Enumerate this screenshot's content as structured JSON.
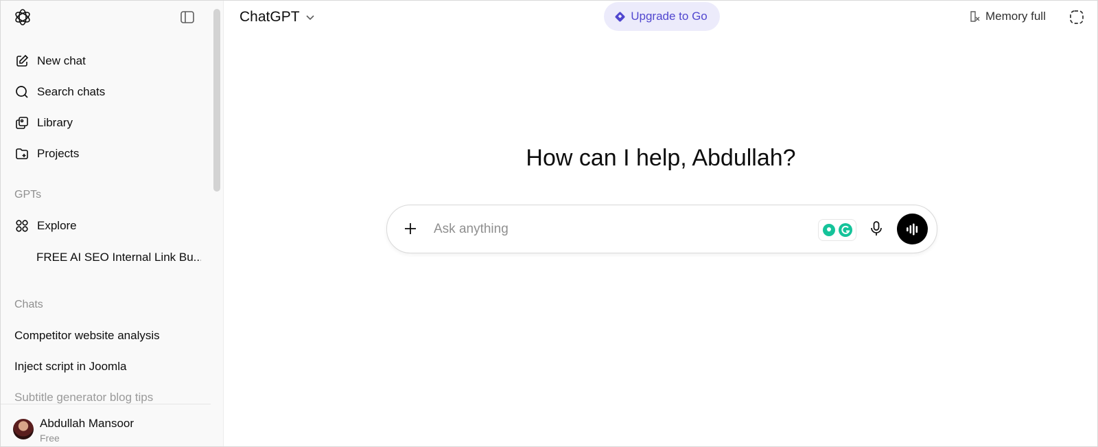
{
  "sidebar": {
    "nav": [
      {
        "label": "New chat",
        "icon": "new-chat-icon"
      },
      {
        "label": "Search chats",
        "icon": "search-icon"
      },
      {
        "label": "Library",
        "icon": "library-icon"
      },
      {
        "label": "Projects",
        "icon": "projects-icon"
      }
    ],
    "gpts_label": "GPTs",
    "explore_label": "Explore",
    "gpt_items": [
      "FREE AI SEO Internal Link Bu..."
    ],
    "chats_label": "Chats",
    "chats": [
      "Competitor website analysis",
      "Inject script in Joomla",
      "Subtitle generator blog tips"
    ],
    "user": {
      "name": "Abdullah Mansoor",
      "plan": "Free"
    }
  },
  "header": {
    "model": "ChatGPT",
    "upgrade_label": "Upgrade to Go",
    "memory_label": "Memory full"
  },
  "main": {
    "greeting": "How can I help, Abdullah?",
    "composer": {
      "placeholder": "Ask anything"
    }
  },
  "colors": {
    "accent": "#5147cf",
    "upgrade_bg": "#ecebfb",
    "sidebar_bg": "#f9f9f9",
    "grammarly": "#15c39a"
  }
}
